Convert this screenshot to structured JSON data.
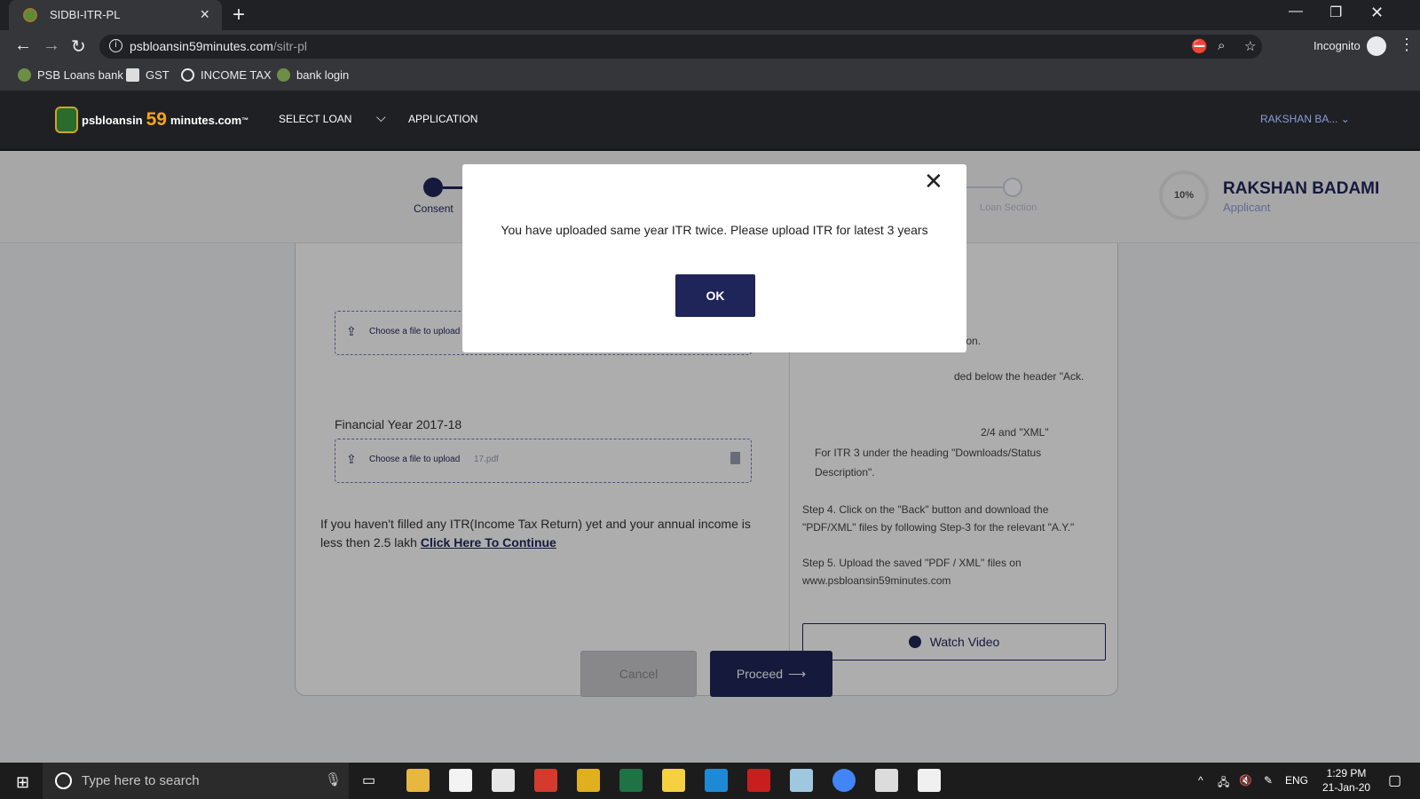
{
  "browser": {
    "tab_title": "SIDBI-ITR-PL",
    "url_host": "psbloansin59minutes.com",
    "url_path": "/sitr-pl",
    "mode_label": "Incognito",
    "bookmarks": [
      "PSB Loans bank",
      "GST",
      "INCOME TAX",
      "bank login"
    ]
  },
  "site": {
    "logo_prefix": "psbloansin",
    "logo_number": "59",
    "logo_suffix": "minutes.com",
    "logo_tm": "™",
    "nav": [
      "SELECT LOAN",
      "APPLICATION"
    ],
    "user_menu": "RAKSHAN BA...",
    "steps": [
      "Consent",
      "Loan Section"
    ],
    "progress_percent": "10%",
    "applicant_name": "RAKSHAN BADAMI",
    "applicant_role": "Applicant"
  },
  "form": {
    "upload_label": "Choose a file to upload",
    "upload_file_2": "17.pdf",
    "financial_year_label": "Financial Year 2017-18",
    "note_text": "If you haven't filled any ITR(Income Tax Return) yet and your annual income is less then 2.5 lakh ",
    "note_link": "Click Here To Continue"
  },
  "instructions": {
    "frag1": "utton.",
    "frag2": "ded below the header \"Ack.",
    "frag3": "2/4 and \"XML\"",
    "itr3_line1": "For ITR 3 under the heading \"Downloads/Status",
    "itr3_line2": "Description\".",
    "step4_line1": "Step 4. Click on the \"Back\" button and download the",
    "step4_line2": "\"PDF/XML\" files by following Step-3 for the relevant \"A.Y.\"",
    "step5_line1": "Step 5. Upload the saved \"PDF / XML\" files on",
    "step5_line2": "www.psbloansin59minutes.com",
    "watch_video": "Watch Video"
  },
  "buttons": {
    "cancel": "Cancel",
    "proceed": "Proceed"
  },
  "modal": {
    "message": "You have uploaded same year ITR twice. Please upload ITR for latest 3 years",
    "ok": "OK"
  },
  "taskbar": {
    "search_placeholder": "Type here to search",
    "language": "ENG",
    "time": "1:29 PM",
    "date": "21-Jan-20"
  },
  "colors": {
    "brand_navy": "#1f2559",
    "logo_orange": "#f4a51c"
  }
}
